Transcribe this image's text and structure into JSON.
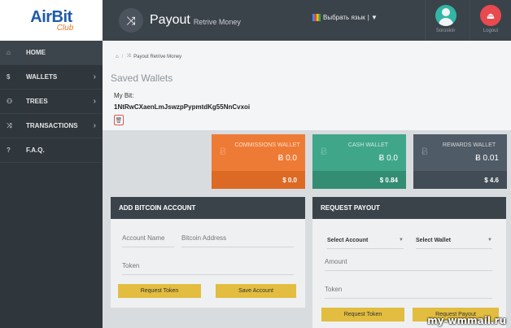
{
  "logo": {
    "main": "AirBit",
    "sub": "Club"
  },
  "sidebar": {
    "items": [
      {
        "icon": "home-icon",
        "glyph": "⌂",
        "label": "HOME",
        "chevron": ""
      },
      {
        "icon": "dollar-icon",
        "glyph": "$",
        "label": "WALLETS",
        "chevron": "›"
      },
      {
        "icon": "users-icon",
        "glyph": "⚇",
        "label": "TREES",
        "chevron": "›"
      },
      {
        "icon": "shuffle-icon",
        "glyph": "⤨",
        "label": "TRANSACTIONS",
        "chevron": "›"
      },
      {
        "icon": "question-icon",
        "glyph": "?",
        "label": "F.A.Q.",
        "chevron": ""
      }
    ]
  },
  "header": {
    "title": "Payout",
    "subtitle": "Retrive Money",
    "language": "Выбрать язык",
    "language_sep": "| ▼",
    "username": "Soroskin",
    "logout": "Logout"
  },
  "breadcrumb": {
    "home": "⌂",
    "sep": "/",
    "current": "Payout Retrive Money"
  },
  "saved_wallets": {
    "title": "Saved Wallets",
    "mybit_label": "My Bit:",
    "address": "1NtRwCXaenLmJswzpPypmtdKg55NnCvxoi"
  },
  "wallets": [
    {
      "name": "COMMISSIONS WALLET",
      "btc": "Ƀ 0.0",
      "usd": "$ 0.0"
    },
    {
      "name": "CASH WALLET",
      "btc": "Ƀ 0.0",
      "usd": "$ 0.84"
    },
    {
      "name": "REWARDS WALLET",
      "btc": "Ƀ 0.01",
      "usd": "$ 4.6"
    }
  ],
  "add_account": {
    "title": "ADD BITCOIN ACCOUNT",
    "account_name_placeholder": "Account Name",
    "address_placeholder": "Bitcoin Address",
    "token_placeholder": "Token",
    "request_token": "Request Token",
    "save_account": "Save Account"
  },
  "request_payout": {
    "title": "REQUEST PAYOUT",
    "select_account": "Select Account",
    "select_wallet": "Select Wallet",
    "amount_placeholder": "Amount",
    "token_placeholder": "Token",
    "request_token": "Request Token",
    "request_payout": "Request Payout"
  },
  "watermark": "my-wmmail.ru",
  "colors": {
    "sidebar": "#2f363c",
    "topbar": "#3b434a",
    "commissions": "#ee7b35",
    "cash": "#3fa689",
    "rewards": "#4f5b66",
    "button": "#e2bd3f"
  }
}
